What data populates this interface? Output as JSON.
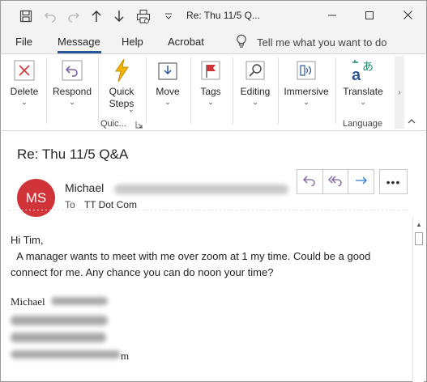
{
  "window": {
    "title": "Re: Thu 11/5 Q...",
    "controls": {
      "minimize": "minimize-icon",
      "maximize": "maximize-icon",
      "close": "close-icon"
    }
  },
  "quick_access": [
    "save-icon",
    "undo-icon",
    "redo-icon",
    "up-arrow-icon",
    "down-arrow-icon",
    "print-icon",
    "customize-icon"
  ],
  "menu": {
    "tabs": [
      "File",
      "Message",
      "Help",
      "Acrobat"
    ],
    "active_tab": "Message",
    "tell_me": "Tell me what you want to do"
  },
  "ribbon": {
    "delete": "Delete",
    "respond": "Respond",
    "quick_steps_1": "Quick",
    "quick_steps_2": "Steps",
    "quick_group": "Quic...",
    "move": "Move",
    "tags": "Tags",
    "editing": "Editing",
    "immersive": "Immersive",
    "translate": "Translate",
    "language_group": "Language",
    "accent_red": "#d13438",
    "accent_purple": "#7b5fa7",
    "accent_blue": "#2b579a"
  },
  "message": {
    "subject": "Re: Thu 11/5 Q&A",
    "avatar_initials": "MS",
    "sender_name": "Michael",
    "to_label": "To",
    "to_value": "TT Dot Com",
    "actions": [
      "reply-icon",
      "reply-all-icon",
      "forward-icon"
    ],
    "more": "•••",
    "body": {
      "greeting": "Hi Tim,",
      "paragraph": "  A manager wants to meet with me over zoom at 1 my time. Could be a good connect for me. Any chance you can do noon your time?",
      "signature_name": "Michael",
      "signature_tail": "m"
    }
  }
}
